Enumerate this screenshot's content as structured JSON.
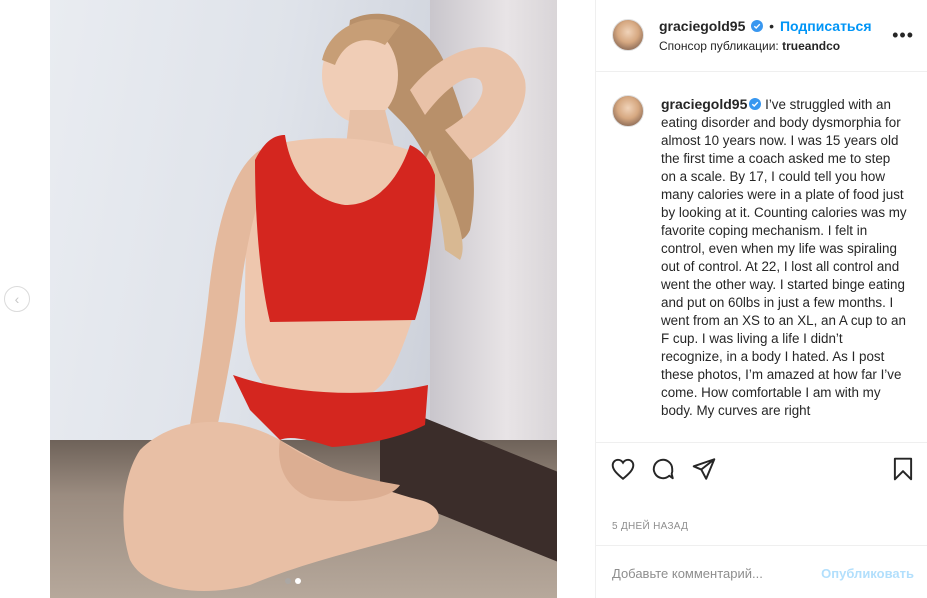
{
  "post": {
    "slide_count": 2,
    "active_slide": 2
  },
  "header": {
    "username": "graciegold95",
    "separator": "•",
    "follow_label": "Подписаться",
    "sponsor_prefix": "Спонсор публикации: ",
    "sponsor_name": "trueandco",
    "more_label": "•••"
  },
  "caption": {
    "username": "graciegold95",
    "text": "I’ve struggled with an eating disorder and body dysmorphia for almost 10 years now. I was 15 years old the first time a coach asked me to step on a scale. By 17, I could tell you how many calories were in a plate of food just by looking at it. Counting calories was my favorite coping mechanism. I felt in control, even when my life was spiraling out of control. At 22, I lost all control and went the other way. I started binge eating and put on 60lbs in just a few months. I went from an XS to an XL, an A cup to an F cup. I was living a life I didn’t recognize, in a body I hated. As I post these photos, I’m amazed at how far I’ve come. How comfortable I am with my body. My curves are right"
  },
  "actions": {
    "like_icon": "heart-icon",
    "comment_icon": "comment-icon",
    "share_icon": "paper-plane-icon",
    "save_icon": "bookmark-icon"
  },
  "date": "5 ДНЕЙ НАЗАД",
  "comment": {
    "placeholder": "Добавьте комментарий...",
    "publish_label": "Опубликовать"
  },
  "nav": {
    "prev_icon": "chevron-left-icon",
    "prev_glyph": "‹"
  },
  "colors": {
    "accent": "#0095f6",
    "publish_disabled": "#b2dffc",
    "outfit": "#d4261f"
  }
}
